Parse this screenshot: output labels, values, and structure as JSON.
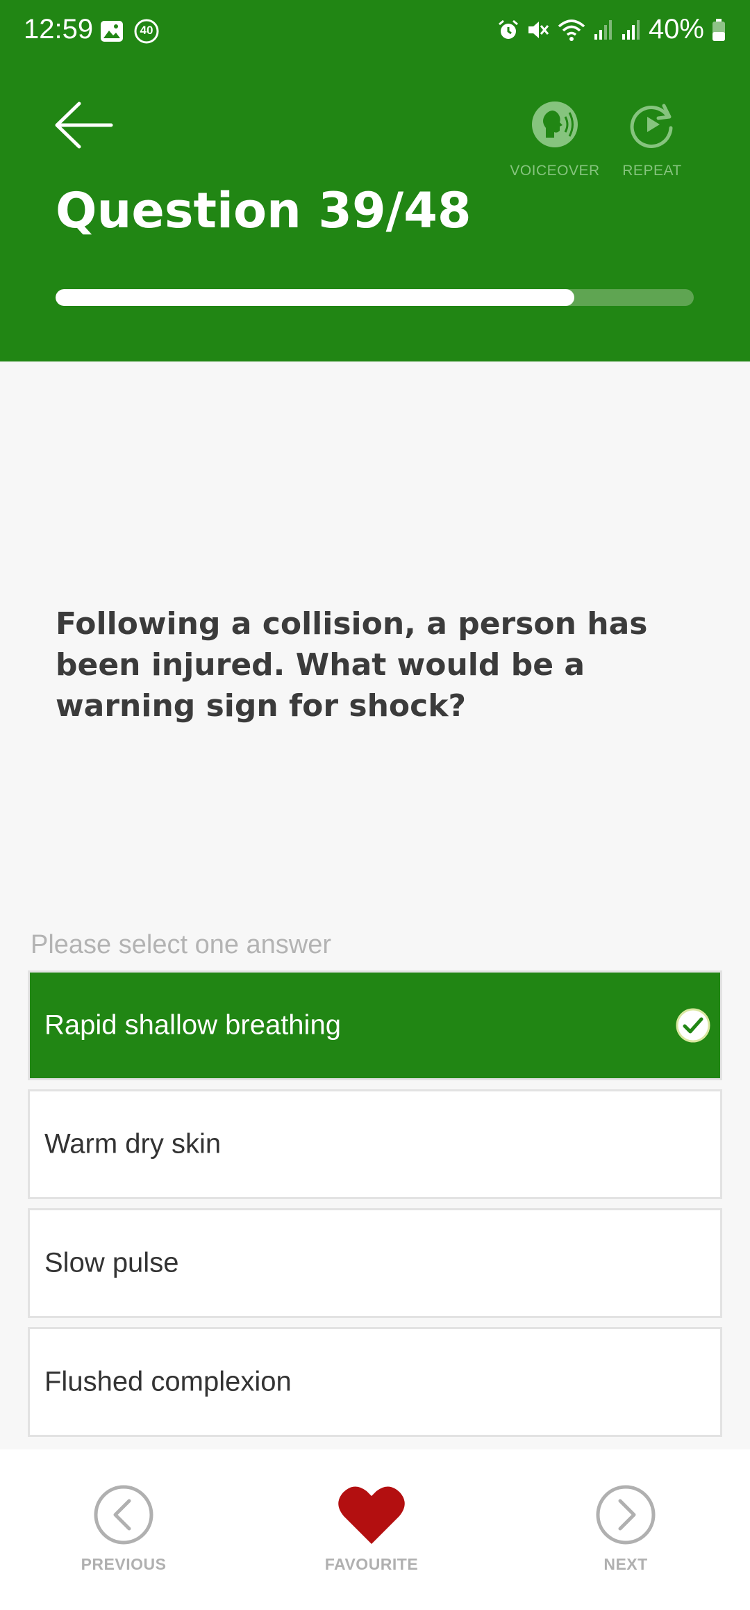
{
  "status_bar": {
    "time": "12:59",
    "notification_badge": "40",
    "battery_text": "40%"
  },
  "header": {
    "question_title": "Question 39/48",
    "progress_fraction": 0.8125,
    "voiceover_label": "VOICEOVER",
    "repeat_label": "REPEAT",
    "accent_color": "#218614"
  },
  "question": {
    "text": "Following a collision, a person has been injured. What would be a warning sign for shock?",
    "instruction": "Please select one answer"
  },
  "answers": [
    {
      "label": "Rapid shallow breathing",
      "selected": true
    },
    {
      "label": "Warm dry skin",
      "selected": false
    },
    {
      "label": "Slow pulse",
      "selected": false
    },
    {
      "label": "Flushed complexion",
      "selected": false
    }
  ],
  "bottom_nav": {
    "previous_label": "PREVIOUS",
    "favourite_label": "FAVOURITE",
    "next_label": "NEXT",
    "favourite_color": "#b30f10"
  },
  "icons": [
    "back-arrow-icon",
    "voiceover-icon",
    "repeat-icon",
    "check-icon",
    "chevron-left-icon",
    "heart-icon",
    "chevron-right-icon"
  ]
}
